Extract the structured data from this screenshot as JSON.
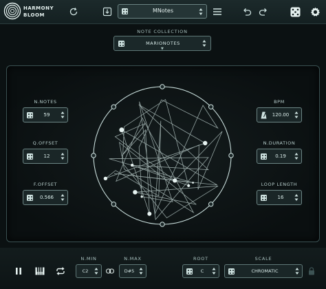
{
  "app": {
    "name_line1": "HARMONY",
    "name_line2": "BLOOM"
  },
  "toolbar": {
    "preset_name": "MNotes",
    "icons": [
      "refresh-icon",
      "save-icon",
      "dice-icon",
      "menu-icon",
      "undo-icon",
      "redo-icon",
      "dice-icon",
      "gear-icon"
    ]
  },
  "note_collection": {
    "title": "NOTE COLLECTION",
    "value": "MARIONOTES"
  },
  "left_params": [
    {
      "title": "N.NOTES",
      "value": "59"
    },
    {
      "title": "Q.OFFSET",
      "value": "12"
    },
    {
      "title": "F.OFFSET",
      "value": "0.566"
    }
  ],
  "right_params": [
    {
      "title": "BPM",
      "value": "120.00"
    },
    {
      "title": "N.DURATION",
      "value": "0.19"
    },
    {
      "title": "LOOP LENGTH",
      "value": "16"
    }
  ],
  "bottom": {
    "n_min": {
      "title": "N.MIN",
      "value": "C2"
    },
    "n_max": {
      "title": "N.MAX",
      "value": "D#5"
    },
    "root": {
      "title": "ROOT",
      "value": "C"
    },
    "scale": {
      "title": "SCALE",
      "value": "CHROMATIC"
    }
  },
  "colors": {
    "accent": "#cfe3e1",
    "background": "#0b1112",
    "border": "#6d8685"
  }
}
